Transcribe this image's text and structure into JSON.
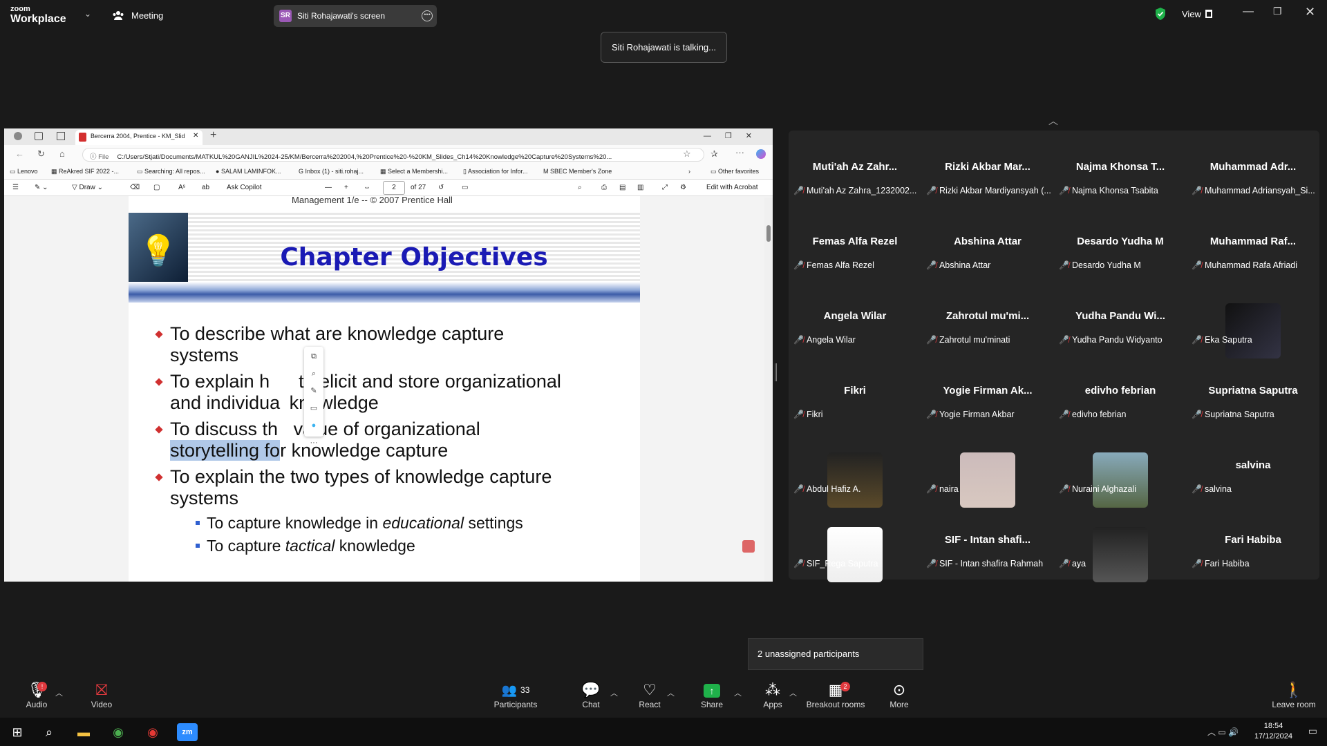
{
  "topbar": {
    "logo_top": "zoom",
    "logo_bottom": "Workplace",
    "meeting_label": "Meeting",
    "screen_badge": "SR",
    "screen_tab_label": "Siti Rohajawati's screen",
    "view_label": "View"
  },
  "talking": "Siti Rohajawati is talking...",
  "browser": {
    "tab_title": "Bercerra 2004, Prentice - KM_Slid",
    "file_label": "File",
    "address": "C:/Users/Stjati/Documents/MATKUL%20GANJIL%2024-25/KM/Bercerra%202004,%20Prentice%20-%20KM_Slides_Ch14%20Knowledge%20Capture%20Systems%20...",
    "favorites": [
      "Lenovo",
      "ReAkred SIF 2022 -...",
      "Searching: All repos...",
      "SALAM LAMINFOK...",
      "Inbox (1) - siti.rohaj...",
      "Select a Membershi...",
      "Association for Infor...",
      "SBEC Member's Zone"
    ],
    "other_favorites": "Other favorites",
    "pdf_toolbar": {
      "draw": "Draw",
      "ask_copilot": "Ask Copilot",
      "page": "2",
      "of_pages": "of 27",
      "edit_acrobat": "Edit with Acrobat"
    }
  },
  "slide": {
    "top_text": "Management 1/e -- © 2007 Prentice Hall",
    "title": "Chapter Objectives",
    "bullets": [
      "To describe what are knowledge capture systems",
      "To explain how to elicit and store organizational and individual knowledge",
      "To discuss the value of organizational storytelling for knowledge capture",
      "To explain the two types of knowledge capture systems"
    ],
    "b1a": "To describe what are knowledge capture",
    "b1b": "systems",
    "b2a": "To explain h",
    "b2b": " to elicit and store organizational",
    "b2c": "and individua",
    "b2d": " knowledge",
    "b3a": "To discuss th",
    "b3b": " value of organizational",
    "b3c": "storytelling fo",
    "b3d": "r knowledge capture",
    "b4a": "To explain the two types of  knowledge capture",
    "b4b": "systems",
    "sub1a": "To capture knowledge in ",
    "sub1b": "educational",
    "sub1c": " settings",
    "sub2a": "To capture ",
    "sub2b": "tactical",
    "sub2c": " knowledge"
  },
  "participants": [
    {
      "title": "Muti'ah Az Zahr...",
      "label": "Muti'ah Az Zahra_1232002..."
    },
    {
      "title": "Rizki Akbar Mar...",
      "label": "Rizki Akbar Mardiyansyah (..."
    },
    {
      "title": "Najma Khonsa T...",
      "label": "Najma Khonsa Tsabita"
    },
    {
      "title": "Muhammad Adr...",
      "label": "Muhammad Adriansyah_Si..."
    },
    {
      "title": "Femas Alfa Rezel",
      "label": "Femas Alfa Rezel"
    },
    {
      "title": "Abshina Attar",
      "label": "Abshina Attar"
    },
    {
      "title": "Desardo Yudha M",
      "label": "Desardo Yudha M"
    },
    {
      "title": "Muhammad Raf...",
      "label": "Muhammad Rafa Afriadi"
    },
    {
      "title": "Angela Wilar",
      "label": "Angela Wilar"
    },
    {
      "title": "Zahrotul mu'mi...",
      "label": "Zahrotul mu'minati"
    },
    {
      "title": "Yudha Pandu Wi...",
      "label": "Yudha Pandu Widyanto"
    },
    {
      "title": "",
      "label": "Eka Saputra"
    },
    {
      "title": "Fikri",
      "label": "Fikri"
    },
    {
      "title": "Yogie Firman Ak...",
      "label": "Yogie Firman Akbar"
    },
    {
      "title": "edivho febrian",
      "label": "edivho febrian"
    },
    {
      "title": "Supriatna Saputra",
      "label": "Supriatna Saputra"
    },
    {
      "title": "",
      "label": "Abdul Hafiz A."
    },
    {
      "title": "",
      "label": "naira"
    },
    {
      "title": "",
      "label": "Nuraini Alghazali"
    },
    {
      "title": "salvina",
      "label": "salvina"
    },
    {
      "title": "",
      "label": "SIF_Rega Saputra"
    },
    {
      "title": "SIF - Intan shafi...",
      "label": "SIF - Intan shafira Rahmah"
    },
    {
      "title": "",
      "label": "aya"
    },
    {
      "title": "Fari Habiba",
      "label": "Fari Habiba"
    }
  ],
  "popup": "2 unassigned participants",
  "toolbar": {
    "audio": "Audio",
    "video": "Video",
    "participants": "Participants",
    "participants_count": "33",
    "chat": "Chat",
    "react": "React",
    "share": "Share",
    "apps": "Apps",
    "breakout": "Breakout rooms",
    "breakout_badge": "2",
    "more": "More",
    "leave": "Leave room",
    "audio_badge": "!"
  },
  "taskbar": {
    "time": "18:54",
    "date": "17/12/2024"
  },
  "colors": {
    "accent_share": "#1fb14a",
    "muted_red": "#e0393e",
    "slide_title": "#1a1ab4"
  }
}
